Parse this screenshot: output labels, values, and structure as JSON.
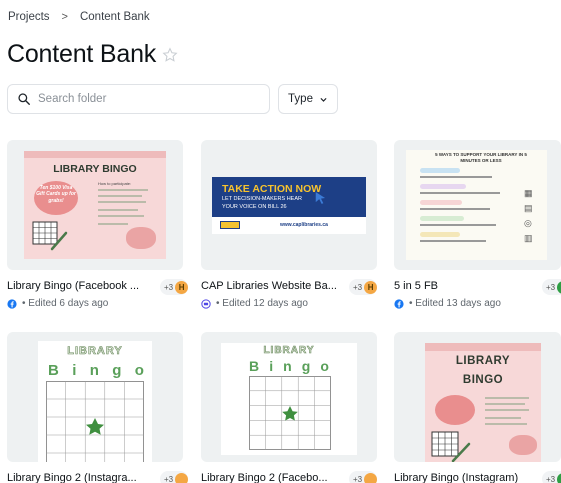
{
  "breadcrumb": {
    "root": "Projects",
    "separator": ">",
    "current": "Content Bank"
  },
  "page": {
    "title": "Content Bank"
  },
  "search": {
    "placeholder": "Search folder"
  },
  "filters": {
    "type_label": "Type"
  },
  "colors": {
    "accent_badge": "#f4a744",
    "facebook": "#1877f2",
    "website": "#4f46e5",
    "text_muted": "#5f666d"
  },
  "cards": [
    {
      "title": "Library Bingo (Facebook ...",
      "collab": "+3",
      "collab_initial": "H",
      "edited": "• Edited 6 days ago",
      "platform_icon": "facebook-icon",
      "thumb": {
        "heading": "LIBRARY BINGO",
        "promo": "Ten $100 Visa Gift Cards up for grabs!",
        "howto": "How to participate:"
      }
    },
    {
      "title": "CAP Libraries Website Ba...",
      "collab": "+3",
      "collab_initial": "H",
      "edited": "• Edited 12 days ago",
      "platform_icon": "website-icon",
      "thumb": {
        "heading": "TAKE ACTION NOW",
        "line1": "LET DECISION-MAKERS HEAR",
        "line2": "YOUR VOICE ON BILL 26",
        "url": "www.caplibraries.ca"
      }
    },
    {
      "title": "5 in 5 FB",
      "collab": "+3",
      "collab_initial": "",
      "edited": "• Edited 13 days ago",
      "platform_icon": "facebook-icon",
      "thumb": {
        "heading": "5 WAYS TO SUPPORT YOUR LIBRARY IN 5 MINUTES OR LESS"
      }
    },
    {
      "title": "Library Bingo 2 (Instagra...",
      "collab": "+3",
      "thumb": {
        "heading": "LIBRARY",
        "letters": [
          "B",
          "i",
          "n",
          "g",
          "o"
        ]
      }
    },
    {
      "title": "Library Bingo 2 (Facebo...",
      "collab": "+3",
      "thumb": {
        "heading": "LIBRARY",
        "letters": [
          "B",
          "i",
          "n",
          "g",
          "o"
        ]
      }
    },
    {
      "title": "Library Bingo (Instagram)",
      "collab": "+3",
      "thumb": {
        "heading1": "LIBRARY",
        "heading2": "BINGO"
      }
    }
  ]
}
